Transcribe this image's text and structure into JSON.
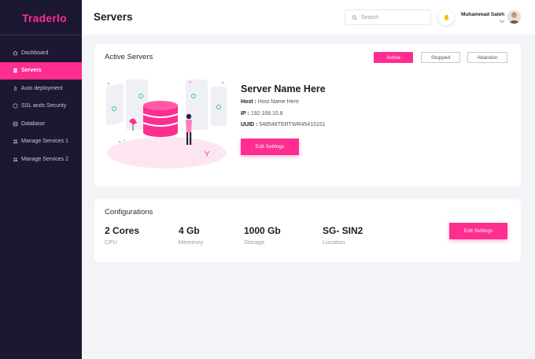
{
  "sidebar": {
    "logo": "Traderlo",
    "items": [
      {
        "label": "Dashboard",
        "icon": "home-icon"
      },
      {
        "label": "Servers",
        "icon": "server-icon",
        "active": true
      },
      {
        "label": "Auto deployment",
        "icon": "rocket-icon"
      },
      {
        "label": "SSL ands Security",
        "icon": "shield-icon"
      },
      {
        "label": "Database",
        "icon": "database-icon"
      },
      {
        "label": "Manage Services 1",
        "icon": "users-icon"
      },
      {
        "label": "Manage Services 2",
        "icon": "users-icon"
      }
    ]
  },
  "header": {
    "title": "Servers",
    "search_placeholder": "Search",
    "user_name": "Muhammad Saleh"
  },
  "active_servers": {
    "title": "Active Servers",
    "filters": [
      "Active",
      "Stopped",
      "Abandon"
    ],
    "server_name": "Server Name Here",
    "host_label": "Host :",
    "host_value": "Host Name Here",
    "ip_label": "IP :",
    "ip_value": "192.168.10.8",
    "uuid_label": "UUID :",
    "uuid_value": "548548TERTWR45415151",
    "edit_button": "Edit Settings"
  },
  "configurations": {
    "title": "Configurations",
    "specs": [
      {
        "value": "2 Cores",
        "label": "CPU"
      },
      {
        "value": "4 Gb",
        "label": "Memeory"
      },
      {
        "value": "1000 Gb",
        "label": "Storage"
      },
      {
        "value": "SG- SIN2",
        "label": "Location"
      }
    ],
    "edit_button": "Edit Settings"
  },
  "colors": {
    "accent": "#ff2d8f",
    "sidebar_bg": "#1c1733",
    "page_bg": "#f3f4f8"
  }
}
